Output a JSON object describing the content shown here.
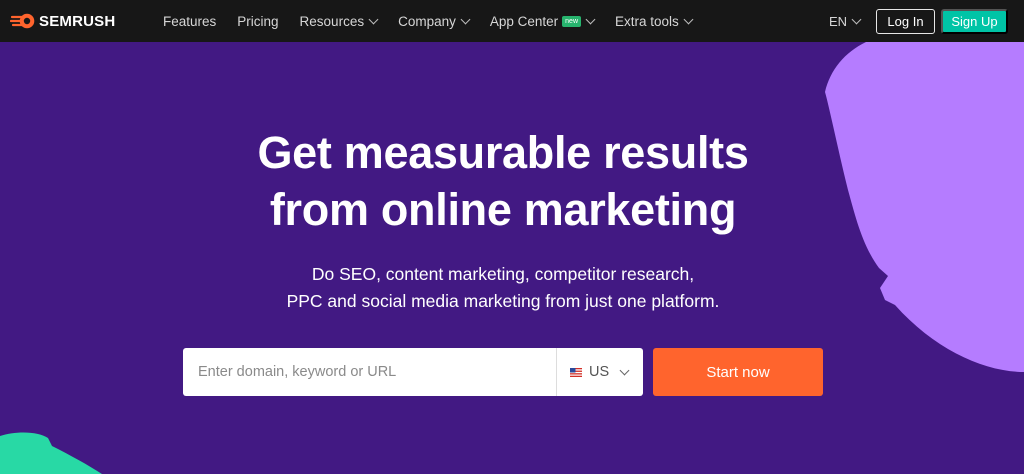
{
  "brand": {
    "name": "SEMRUSH",
    "logo_icon": "semrush-fire-icon",
    "color": "#ff642d"
  },
  "nav": {
    "items": [
      {
        "label": "Features",
        "has_dropdown": false
      },
      {
        "label": "Pricing",
        "has_dropdown": false
      },
      {
        "label": "Resources",
        "has_dropdown": true
      },
      {
        "label": "Company",
        "has_dropdown": true
      },
      {
        "label": "App Center",
        "has_dropdown": true,
        "badge": "new"
      },
      {
        "label": "Extra tools",
        "has_dropdown": true
      }
    ],
    "language": "EN",
    "login_label": "Log In",
    "signup_label": "Sign Up"
  },
  "hero": {
    "title_line1": "Get measurable results",
    "title_line2": "from online marketing",
    "subtitle_line1": "Do SEO, content marketing, competitor research,",
    "subtitle_line2": "PPC and social media marketing from just one platform."
  },
  "search": {
    "placeholder": "Enter domain, keyword or URL",
    "value": "",
    "country": "US",
    "country_icon": "us-flag-icon",
    "button_label": "Start now"
  },
  "colors": {
    "background": "#421983",
    "navbar": "#171717",
    "signup": "#00c4a6",
    "cta": "#ff642d",
    "blob_purple": "#b57cff",
    "blob_green": "#28d9a5",
    "badge": "#27b46e"
  }
}
